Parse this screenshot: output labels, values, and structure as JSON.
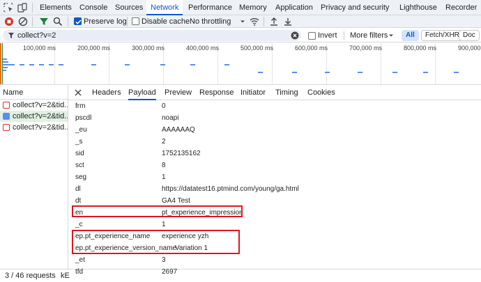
{
  "top_tabs": [
    "Elements",
    "Console",
    "Sources",
    "Network",
    "Performance",
    "Memory",
    "Application",
    "Privacy and security",
    "Lighthouse",
    "Recorder"
  ],
  "active_tab": "Network",
  "toolbar": {
    "preserve_log": "Preserve log",
    "disable_cache": "Disable cache",
    "throttling": "No throttling"
  },
  "filter": {
    "value": "collect?v=2",
    "invert": "Invert",
    "more_filters": "More filters",
    "chips": [
      "All",
      "Fetch/XHR",
      "Doc"
    ]
  },
  "timeline": {
    "ticks": [
      "100,000 ms",
      "200,000 ms",
      "300,000 ms",
      "400,000 ms",
      "500,000 ms",
      "600,000 ms",
      "700,000 ms",
      "800,000 ms",
      "900,000 ms"
    ]
  },
  "requests": {
    "header": "Name",
    "items": [
      "collect?v=2&tid...",
      "collect?v=2&tid...",
      "collect?v=2&tid..."
    ]
  },
  "status": {
    "count": "3 / 46 requests",
    "extra": "kE"
  },
  "detail_tabs": [
    "Headers",
    "Payload",
    "Preview",
    "Response",
    "Initiator",
    "Timing",
    "Cookies"
  ],
  "active_detail_tab": "Payload",
  "payload": [
    {
      "key": "frm",
      "value": "0"
    },
    {
      "key": "pscdl",
      "value": "noapi"
    },
    {
      "key": "_eu",
      "value": "AAAAAAQ"
    },
    {
      "key": "_s",
      "value": "2"
    },
    {
      "key": "sid",
      "value": "1752135162"
    },
    {
      "key": "sct",
      "value": "8"
    },
    {
      "key": "seg",
      "value": "1"
    },
    {
      "key": "dl",
      "value": "https://datatest16.ptmind.com/young/ga.html"
    },
    {
      "key": "dt",
      "value": "GA4 Test"
    },
    {
      "key": "en",
      "value": "pt_experience_impression"
    },
    {
      "key": "_c",
      "value": "1"
    },
    {
      "key": "ep.pt_experience_name",
      "value": "experience yzh"
    },
    {
      "key": "ep.pt_experience_version_name",
      "value": "Variation 1"
    },
    {
      "key": "_et",
      "value": "3"
    },
    {
      "key": "tfd",
      "value": "2697"
    }
  ],
  "colors": {
    "accent": "#0b57d0",
    "highlight_box": "#e0161e",
    "record": "#d93025",
    "selected_row": "#e1f0e3"
  }
}
